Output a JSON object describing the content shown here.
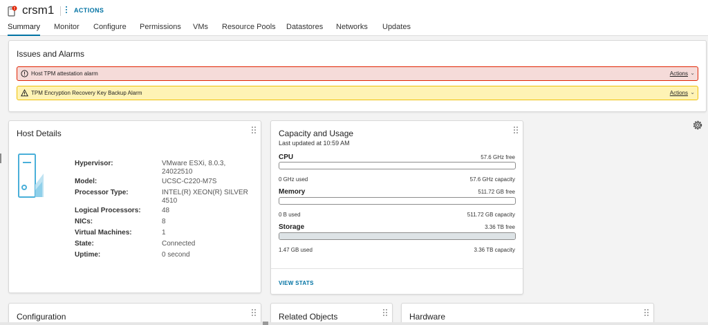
{
  "header": {
    "host_name": "crsm1",
    "actions_label": "ACTIONS",
    "tabs": [
      "Summary",
      "Monitor",
      "Configure",
      "Permissions",
      "VMs",
      "Resource Pools",
      "Datastores",
      "Networks",
      "Updates"
    ],
    "active_tab": "Summary"
  },
  "issues": {
    "title": "Issues and Alarms",
    "alarms": [
      {
        "text": "Host TPM attestation alarm",
        "severity": "error",
        "actions": "Actions"
      },
      {
        "text": "TPM Encryption Recovery Key Backup Alarm",
        "severity": "warning",
        "actions": "Actions"
      }
    ]
  },
  "host_details": {
    "title": "Host Details",
    "rows": [
      {
        "label": "Hypervisor:",
        "value": "VMware ESXi, 8.0.3, 24022510"
      },
      {
        "label": "Model:",
        "value": "UCSC-C220-M7S"
      },
      {
        "label": "Processor Type:",
        "value": "INTEL(R) XEON(R) SILVER 4510"
      },
      {
        "label": "Logical Processors:",
        "value": "48"
      },
      {
        "label": "NICs:",
        "value": "8"
      },
      {
        "label": "Virtual Machines:",
        "value": "1"
      },
      {
        "label": "State:",
        "value": "Connected"
      },
      {
        "label": "Uptime:",
        "value": "0 second"
      }
    ]
  },
  "capacity": {
    "title": "Capacity and Usage",
    "updated": "Last updated at 10:59 AM",
    "resources": [
      {
        "name": "CPU",
        "free": "57.6 GHz free",
        "used": "0 GHz used",
        "capacity": "57.6 GHz capacity",
        "fill_fraction": 0.0
      },
      {
        "name": "Memory",
        "free": "511.72 GB free",
        "used": "0 B used",
        "capacity": "511.72 GB capacity",
        "fill_fraction": 0.0
      },
      {
        "name": "Storage",
        "free": "3.36 TB free",
        "used": "1.47 GB used",
        "capacity": "3.36 TB capacity",
        "fill_fraction": 1.0
      }
    ],
    "view_stats": "VIEW STATS"
  },
  "bottom_cards": {
    "configuration": "Configuration",
    "related_objects": "Related Objects",
    "hardware": "Hardware"
  },
  "colors": {
    "accent": "#0072a3",
    "error_bg": "#f5dbd9",
    "error_border": "#e12200",
    "warning_bg": "#fef3b5",
    "warning_border": "#efc006",
    "host_icon": "#49afd9"
  }
}
